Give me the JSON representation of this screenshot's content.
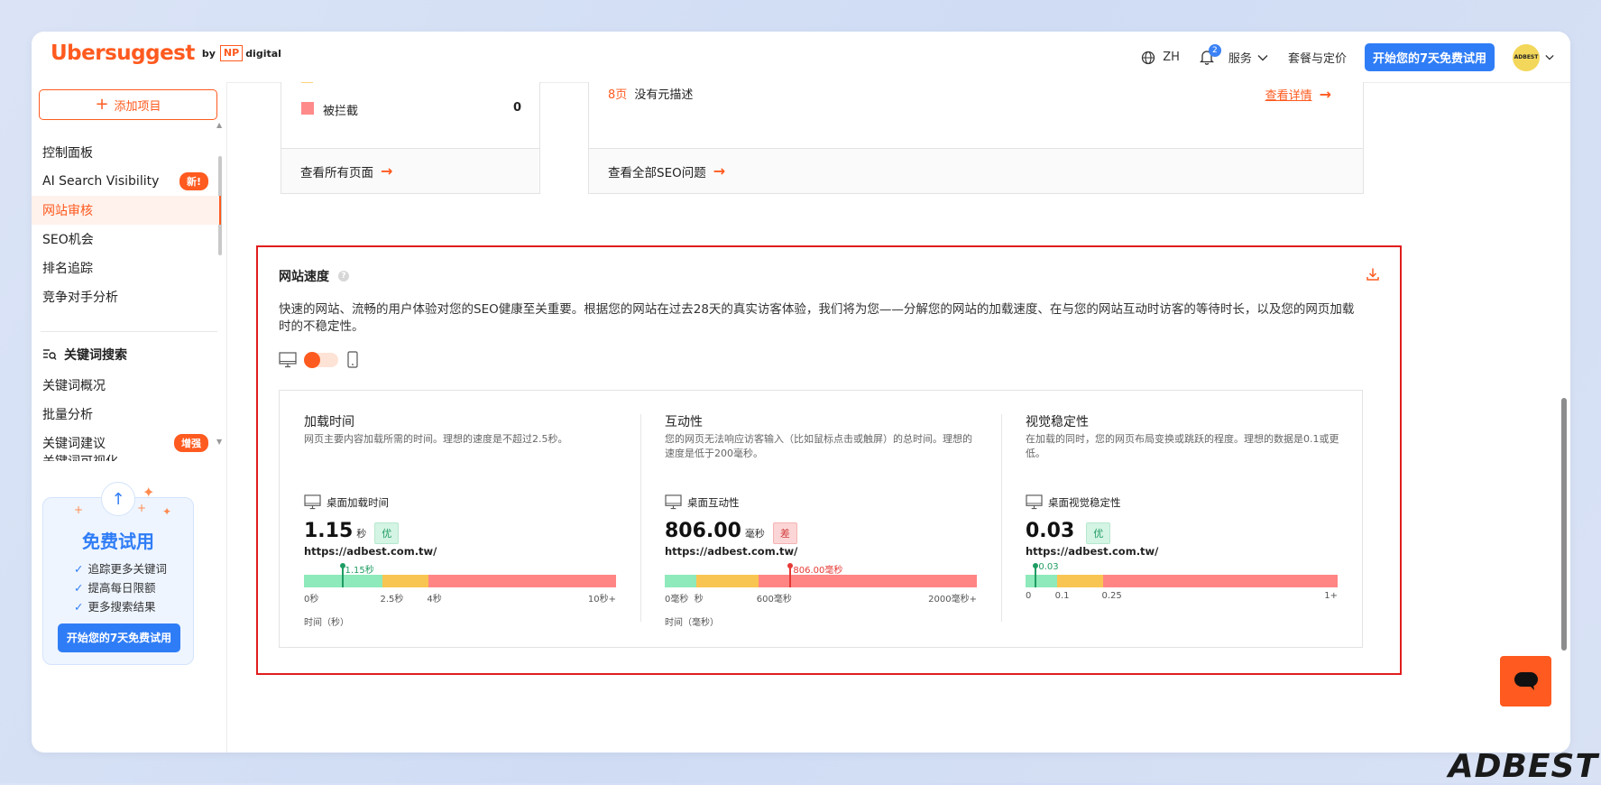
{
  "header": {
    "logo_word": "Ubersuggest",
    "logo_by": "by",
    "logo_np": "NP",
    "logo_digital": "digital",
    "lang": "ZH",
    "notifications": "2",
    "services": "服务",
    "pricing": "套餐与定价",
    "trial": "开始您的7天免费试用",
    "avatar": "ADBEST"
  },
  "sidebar": {
    "add_project": "添加项目",
    "items": [
      {
        "label": "控制面板"
      },
      {
        "label": "AI Search Visibility",
        "badge": "新!"
      },
      {
        "label": "网站审核"
      },
      {
        "label": "SEO机会"
      },
      {
        "label": "排名追踪"
      },
      {
        "label": "竞争对手分析"
      }
    ],
    "section": "关键词搜索",
    "section_items": [
      {
        "label": "关键词概况"
      },
      {
        "label": "批量分析"
      },
      {
        "label": "关键词建议",
        "badge": "增强"
      },
      {
        "label": "关键词可视化"
      }
    ],
    "promo": {
      "title": "免费试用",
      "points": [
        "追踪更多关键词",
        "提高每日限额",
        "更多搜索结果"
      ],
      "button": "开始您的7天免费试用"
    }
  },
  "top_cards": {
    "blocked_label": "被拦截",
    "blocked_value": "0",
    "view_all_pages": "查看所有页面",
    "issue_count": "8页",
    "issue_text": "没有元描述",
    "view_details": "查看详情",
    "view_all_seo": "查看全部SEO问题"
  },
  "speed": {
    "title": "网站速度",
    "description": "快速的网站、流畅的用户体验对您的SEO健康至关重要。根据您的网站在过去28天的真实访客体验，我们将为您——分解您的网站的加载速度、在与您的网站互动时访客的等待时长，以及您的网页加载时的不稳定性。",
    "metrics": [
      {
        "title": "加载时间",
        "desc": "网页主要内容加载所需的时间。理想的速度是不超过2.5秒。",
        "sub": "桌面加载时间",
        "value": "1.15",
        "unit": "秒",
        "grade": "优",
        "url": "https://adbest.com.tw/",
        "marker_label": "1.15秒",
        "marker_pos": 0.12,
        "segments": [
          0.25,
          0.15,
          0.6
        ],
        "ticks": [
          "0秒",
          "2.5秒",
          "4秒",
          "10秒+"
        ],
        "axis": "时间（秒）"
      },
      {
        "title": "互动性",
        "desc": "您的网页无法响应访客输入（比如鼠标点击或触屏）的总时间。理想的速度是低于200毫秒。",
        "sub": "桌面互动性",
        "value": "806.00",
        "unit": "毫秒",
        "grade": "差",
        "url": "https://adbest.com.tw/",
        "marker_label": "806.00毫秒",
        "marker_pos": 0.4,
        "segments": [
          0.1,
          0.2,
          0.7
        ],
        "ticks": [
          "0毫秒",
          "秒",
          "600毫秒",
          "2000毫秒+"
        ],
        "axis": "时间（毫秒）"
      },
      {
        "title": "视觉稳定性",
        "desc": "在加载的同时，您的网页布局变换或跳跃的程度。理想的数据是0.1或更低。",
        "sub": "桌面视觉稳定性",
        "value": "0.03",
        "unit": "",
        "grade": "优",
        "url": "https://adbest.com.tw/",
        "marker_label": "0.03",
        "marker_pos": 0.03,
        "segments": [
          0.1,
          0.15,
          0.75
        ],
        "ticks": [
          "0",
          "0.1",
          "0.25",
          "1+"
        ],
        "axis": ""
      }
    ]
  },
  "watermark": "ADBEST"
}
